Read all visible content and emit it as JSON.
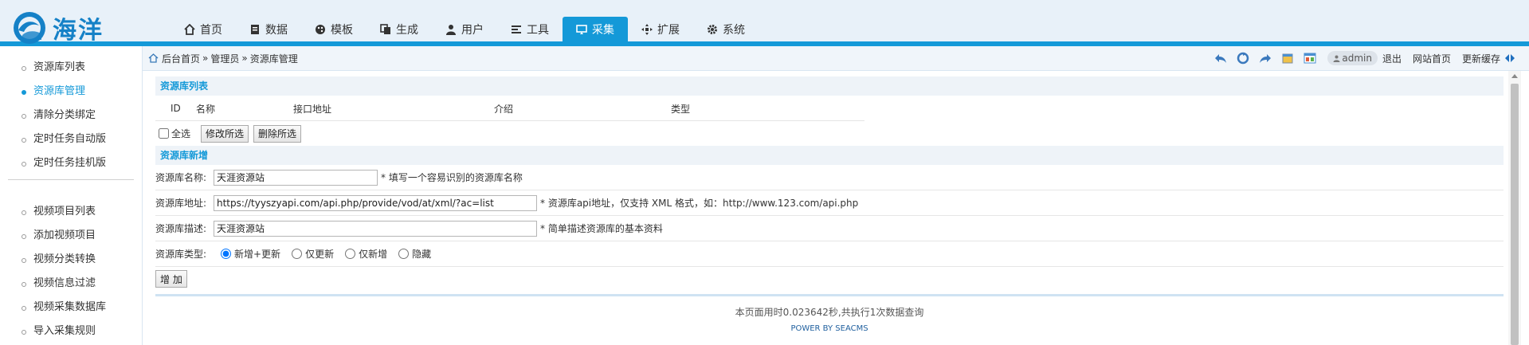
{
  "brand": {
    "name": "海洋"
  },
  "nav": [
    {
      "label": "首页",
      "icon": "home-icon"
    },
    {
      "label": "数据",
      "icon": "database-icon"
    },
    {
      "label": "模板",
      "icon": "palette-icon"
    },
    {
      "label": "生成",
      "icon": "copy-icon"
    },
    {
      "label": "用户",
      "icon": "user-icon"
    },
    {
      "label": "工具",
      "icon": "tools-icon"
    },
    {
      "label": "采集",
      "icon": "collect-icon",
      "active": true
    },
    {
      "label": "扩展",
      "icon": "expand-icon"
    },
    {
      "label": "系统",
      "icon": "gear-icon"
    }
  ],
  "sidebar": {
    "group1": [
      "资源库列表",
      "资源库管理",
      "清除分类绑定",
      "定时任务自动版",
      "定时任务挂机版"
    ],
    "active": "资源库管理",
    "group2": [
      "视频项目列表",
      "添加视频项目",
      "视频分类转换",
      "视频信息过滤",
      "视频采集数据库",
      "导入采集规则"
    ]
  },
  "breadcrumb": {
    "home": "后台首页",
    "sep": "»",
    "level1": "管理员",
    "level2": "资源库管理"
  },
  "topbar": {
    "user": "admin",
    "logout": "退出",
    "site_home": "网站首页",
    "clear_cache": "更新缓存"
  },
  "list_section": {
    "title": "资源库列表",
    "columns": [
      "ID",
      "名称",
      "接口地址",
      "介绍",
      "类型"
    ],
    "select_all": "全选",
    "edit_selected": "修改所选",
    "delete_selected": "删除所选"
  },
  "add_section": {
    "title": "资源库新增",
    "name": {
      "label": "资源库名称:",
      "value": "天涯资源站",
      "hint": "* 填写一个容易识别的资源库名称"
    },
    "url": {
      "label": "资源库地址:",
      "value": "https://tyyszyapi.com/api.php/provide/vod/at/xml/?ac=list",
      "hint": "* 资源库api地址，仅支持 XML 格式，如：http://www.123.com/api.php"
    },
    "desc": {
      "label": "资源库描述:",
      "value": "天涯资源站",
      "hint": "* 简单描述资源库的基本资料"
    },
    "type": {
      "label": "资源库类型:",
      "options": [
        "新增+更新",
        "仅更新",
        "仅新增",
        "隐藏"
      ],
      "selected": "新增+更新"
    },
    "submit": "增 加"
  },
  "footer": {
    "stats": "本页面用时0.023642秒,共执行1次数据查询",
    "powered": "POWER BY SEACMS"
  },
  "colors": {
    "accent": "#1499d8",
    "logo": "#1581c7"
  }
}
